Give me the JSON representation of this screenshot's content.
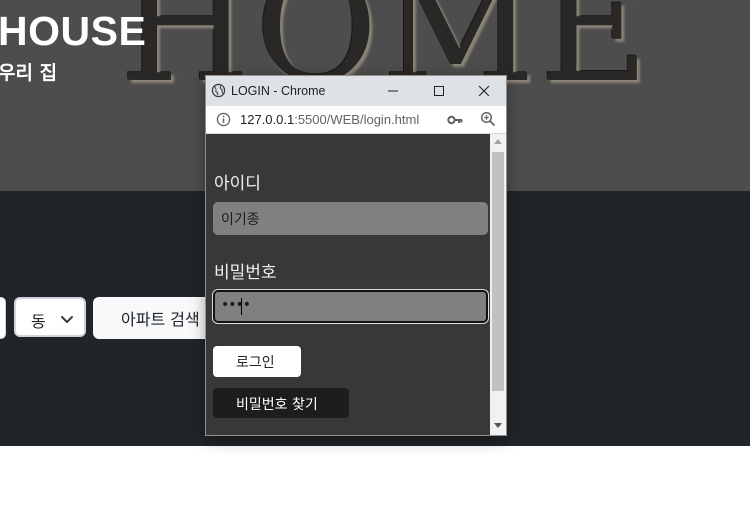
{
  "background": {
    "hero_word": "HOME",
    "brand_title": "HOUSE",
    "brand_subtitle": "우리 집",
    "dong_select": {
      "selected": "동"
    },
    "apartment_search_label": "아파트 검색"
  },
  "popup": {
    "title": "LOGIN - Chrome",
    "url_host": "127.0.0.1",
    "url_rest": ":5500/WEB/login.html",
    "id_label": "아이디",
    "id_value": "이기종",
    "password_label": "비밀번호",
    "password_masked": "••••",
    "login_button": "로그인",
    "find_password_button": "비밀번호 찾기"
  },
  "colors": {
    "hero_bg": "#4d4d4d",
    "dark_band": "#212529",
    "popup_bg": "#383838",
    "field_bg": "#808080",
    "titlebar_bg": "#dee1e6"
  }
}
